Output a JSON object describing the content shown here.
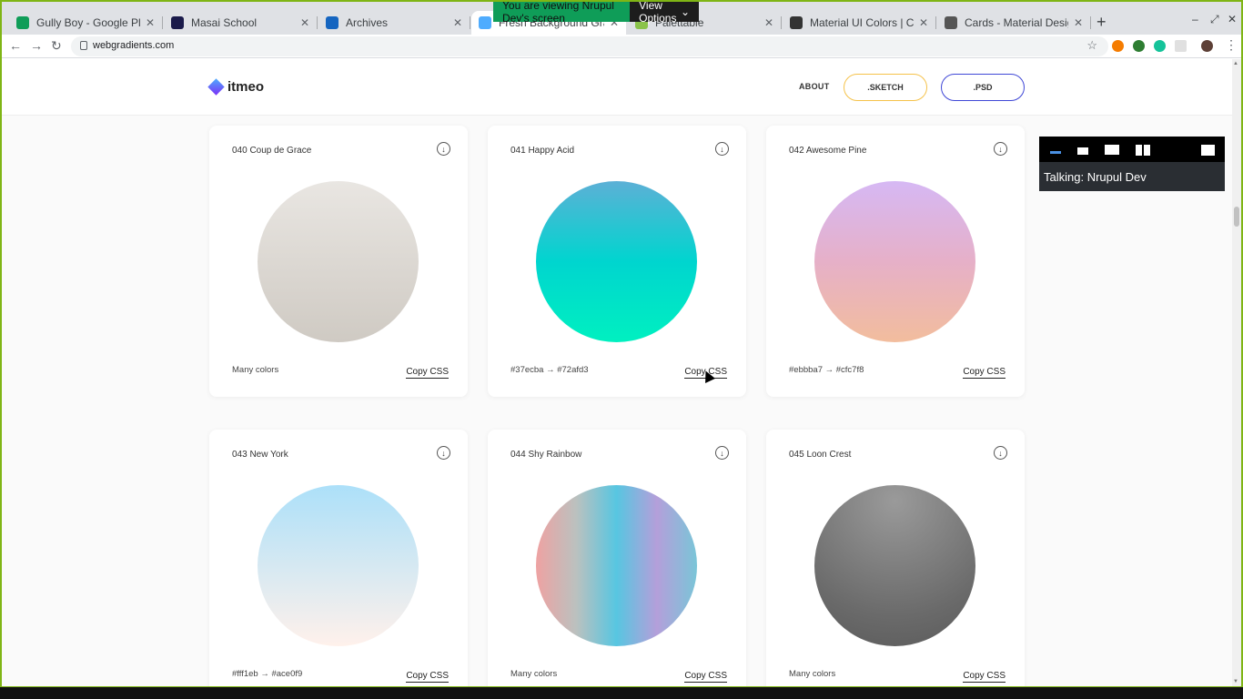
{
  "browser": {
    "tabs": [
      {
        "title": "Gully Boy - Google Play N",
        "favicon_color": "#0f9d58",
        "active": false
      },
      {
        "title": "Masai School",
        "favicon_color": "#1a1a4a",
        "active": false
      },
      {
        "title": "Archives",
        "favicon_color": "#1565c0",
        "active": false
      },
      {
        "title": "Fresh Background Gradi",
        "favicon_color": "#4facfe",
        "active": true
      },
      {
        "title": "Palettable",
        "favicon_color": "#8bc34a",
        "active": false
      },
      {
        "title": "Material UI Colors | Colo",
        "favicon_color": "#333333",
        "active": false
      },
      {
        "title": "Cards - Material Design",
        "favicon_color": "#555555",
        "active": false
      }
    ],
    "new_tab_label": "+",
    "url": "webgradients.com"
  },
  "banner": {
    "message": "You are viewing Nrupul Dev's screen",
    "view_options": "View Options"
  },
  "site": {
    "logo_text": "itmeo",
    "nav_about": "ABOUT",
    "btn_sketch": ".SKETCH",
    "btn_psd": ".PSD"
  },
  "cards": [
    {
      "name": "040 Coup de Grace",
      "info": "Many colors",
      "copy": "Copy CSS",
      "gradient": "linear-gradient(to top,#cfcac3,#e9e6e2)"
    },
    {
      "name": "041 Happy Acid",
      "info": "#37ecba  →  #72afd3",
      "copy": "Copy CSS",
      "gradient": "linear-gradient(to top,#00f0c0,#00d5cf,#5cb0d6)"
    },
    {
      "name": "042 Awesome Pine",
      "info": "#ebbba7  →  #cfc7f8",
      "copy": "Copy CSS",
      "gradient": "linear-gradient(to top,#f2bd9d,#e6b0c8,#d6b8f4)"
    },
    {
      "name": "043 New York",
      "info": "#fff1eb  →  #ace0f9",
      "copy": "Copy CSS",
      "gradient": "linear-gradient(to top,#fff1eb,#ace0f9)"
    },
    {
      "name": "044 Shy Rainbow",
      "info": "Many colors",
      "copy": "Copy CSS",
      "gradient": "linear-gradient(to right,#eea2a2,#bbc1bf,#57c6e1,#b49fda,#7ac5d8)"
    },
    {
      "name": "045 Loon Crest",
      "info": "Many colors",
      "copy": "Copy CSS",
      "gradient": "radial-gradient(circle at 50% 10%,#9a9a9a,#6a6a6a 70%,#5a5a5a)"
    }
  ],
  "float_panel": {
    "talking": "Talking: Nrupul Dev"
  }
}
